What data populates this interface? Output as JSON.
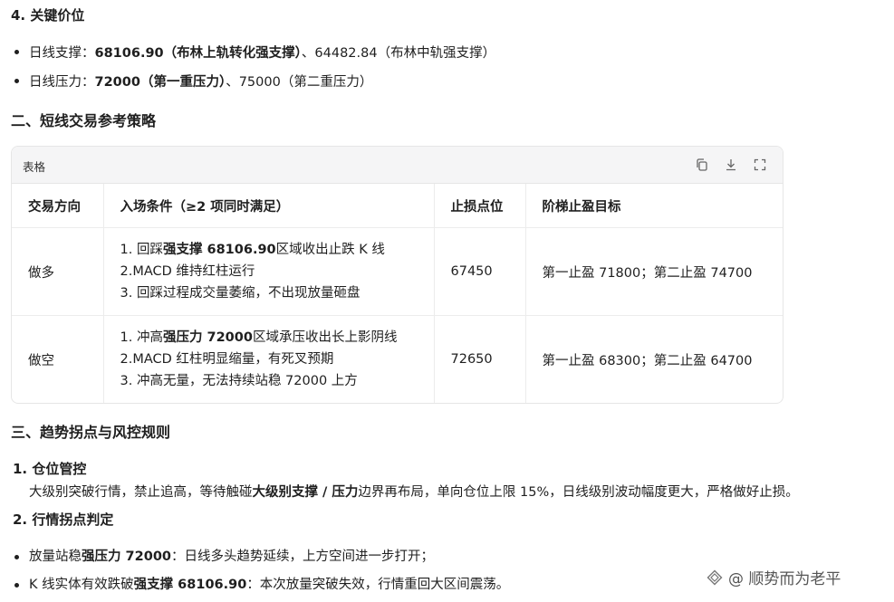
{
  "section4": {
    "title": "4. 关键价位",
    "support": {
      "prefix": "日线支撑：",
      "bold": "68106.90（布林上轨转化强支撑）",
      "rest": "、64482.84（布林中轨强支撑）"
    },
    "pressure": {
      "prefix": "日线压力：",
      "bold": "72000（第一重压力）",
      "rest": "、75000（第二重压力）"
    }
  },
  "section_two": {
    "title": "二、短线交易参考策略"
  },
  "table": {
    "caption": "表格",
    "headers": [
      "交易方向",
      "入场条件（≥2 项同时满足）",
      "止损点位",
      "阶梯止盈目标"
    ],
    "rows": [
      {
        "direction": "做多",
        "cond1_pre": "1. 回踩",
        "cond1_bold": "强支撑 68106.90",
        "cond1_post": "区域收出止跌 K 线",
        "cond2": "2.MACD 维持红柱运行",
        "cond3": "3. 回踩过程成交量萎缩，不出现放量砸盘",
        "stop": "67450",
        "target": "第一止盈 71800；第二止盈 74700"
      },
      {
        "direction": "做空",
        "cond1_pre": "1. 冲高",
        "cond1_bold": "强压力 72000",
        "cond1_post": "区域承压收出长上影阴线",
        "cond2": "2.MACD 红柱明显缩量，有死叉预期",
        "cond3": "3. 冲高无量，无法持续站稳 72000 上方",
        "stop": "72650",
        "target": "第一止盈 68300；第二止盈 64700"
      }
    ]
  },
  "section_three": {
    "title": "三、趋势拐点与风控规则",
    "item1_title": "1. 仓位管控",
    "item1_pre": "大级别突破行情，禁止追高，等待触碰",
    "item1_bold": "大级别支撑 / 压力",
    "item1_post": "边界再布局，单向仓位上限 15%，日线级别波动幅度更大，严格做好止损。",
    "item2_title": "2. 行情拐点判定",
    "bullet1_pre": "放量站稳",
    "bullet1_bold": "强压力 72000",
    "bullet1_post": "：日线多头趋势延续，上方空间进一步打开；",
    "bullet2_pre": "K 线实体有效跌破",
    "bullet2_bold": "强支撑 68106.90",
    "bullet2_post": "：本次放量突破失效，行情重回大区间震荡。"
  },
  "watermark": "@ 顺势而为老平"
}
